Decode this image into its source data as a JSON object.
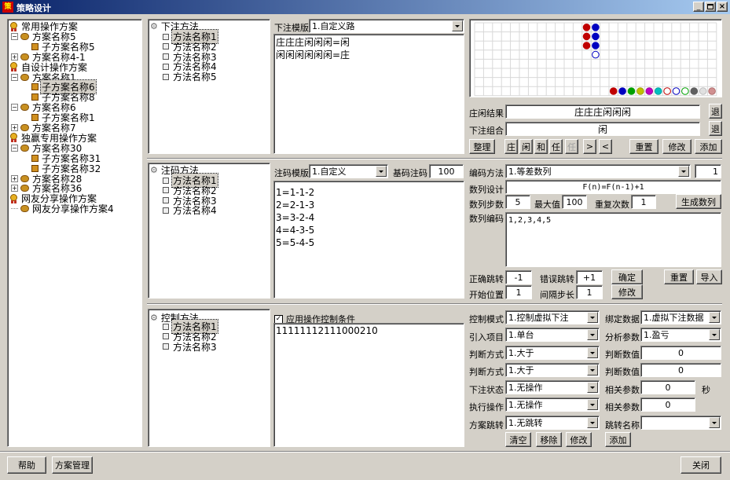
{
  "window": {
    "title": "策略设计"
  },
  "tree": {
    "items": [
      {
        "label": "常用操作方案",
        "level": 0,
        "icon": "award-icon"
      },
      {
        "label": "方案名称5",
        "level": 1,
        "icon": "plan-icon",
        "expand": "−"
      },
      {
        "label": "子方案名称5",
        "level": 2,
        "icon": "subplan-icon"
      },
      {
        "label": "方案名称4-1",
        "level": 1,
        "icon": "plan-icon",
        "expand": "+"
      },
      {
        "label": "自设计操作方案",
        "level": 0,
        "icon": "award-icon"
      },
      {
        "label": "方案名称1",
        "level": 1,
        "icon": "plan-icon",
        "expand": "−"
      },
      {
        "label": "子方案名称6",
        "level": 2,
        "icon": "subplan-icon",
        "selected": true
      },
      {
        "label": "子方案名称8",
        "level": 2,
        "icon": "subplan-icon"
      },
      {
        "label": "方案名称6",
        "level": 1,
        "icon": "plan-icon",
        "expand": "−"
      },
      {
        "label": "子方案名称1",
        "level": 2,
        "icon": "subplan-icon"
      },
      {
        "label": "方案名称7",
        "level": 1,
        "icon": "plan-icon",
        "expand": "+"
      },
      {
        "label": "独赢专用操作方案",
        "level": 0,
        "icon": "award-icon"
      },
      {
        "label": "方案名称30",
        "level": 1,
        "icon": "plan-icon",
        "expand": "−"
      },
      {
        "label": "子方案名称31",
        "level": 2,
        "icon": "subplan-icon"
      },
      {
        "label": "子方案名称32",
        "level": 2,
        "icon": "subplan-icon"
      },
      {
        "label": "方案名称28",
        "level": 1,
        "icon": "plan-icon",
        "expand": "+"
      },
      {
        "label": "方案名称36",
        "level": 1,
        "icon": "plan-icon",
        "expand": "+"
      },
      {
        "label": "网友分享操作方案",
        "level": 0,
        "icon": "award-icon"
      },
      {
        "label": "网友分享操作方案4",
        "level": 1,
        "icon": "plan-icon"
      }
    ]
  },
  "bet": {
    "root": "下注方法",
    "items": [
      "方法名称1",
      "方法名称2",
      "方法名称3",
      "方法名称4",
      "方法名称5"
    ],
    "template_label": "下注模版",
    "template_value": "1.自定义路",
    "lines": [
      "庄庄庄闲闲闲=闲",
      "闲闲闲闲闲闲=庄"
    ]
  },
  "bead": {
    "colors": [
      "#c00000",
      "#0000c0",
      "#00a000",
      "#c0c000",
      "#c000c0",
      "#00c0c0",
      "#ffffff",
      "#ffffff",
      "#ffffff",
      "#606060",
      "#e0e0e0",
      "#d09090"
    ]
  },
  "result": {
    "label": "庄闲结果",
    "value": "庄庄庄闲闲闲",
    "combo_label": "下注组合",
    "combo_value": "闲",
    "back1": "退",
    "back2": "退"
  },
  "toolbar": {
    "tidy": "整理",
    "zhuang": "庄",
    "xian": "闲",
    "he": "和",
    "ren": "任",
    "disabled": "任",
    "right": ">",
    "left": "<",
    "reset": "重置",
    "edit": "修改",
    "add": "添加"
  },
  "chip": {
    "root": "注码方法",
    "items": [
      "方法名称1",
      "方法名称2",
      "方法名称3",
      "方法名称4"
    ],
    "template_label": "注码模版",
    "template_value": "1.自定义",
    "base_label": "基码注码",
    "base_value": "100",
    "lines": [
      "1=1-1-2",
      "2=2-1-3",
      "3=3-2-4",
      "4=4-3-5",
      "5=5-4-5"
    ]
  },
  "seq": {
    "method_label": "编码方法",
    "method_value": "1.等差数列",
    "method_num": "1",
    "design_label": "数列设计",
    "design_value": "F(n)=F(n-1)+1",
    "step_label": "数列步数",
    "step_value": "5",
    "max_label": "最大值",
    "max_value": "100",
    "repeat_label": "重复次数",
    "repeat_value": "1",
    "gen_btn": "生成数列",
    "code_label": "数列编码",
    "code_value": "1,2,3,4,5",
    "ok_jump_label": "正确跳转",
    "ok_jump_value": "-1",
    "err_jump_label": "错误跳转",
    "err_jump_value": "+1",
    "confirm": "确定",
    "reset": "重置",
    "import": "导入",
    "start_label": "开始位置",
    "start_value": "1",
    "interval_label": "间隔步长",
    "interval_value": "1",
    "edit": "修改"
  },
  "control": {
    "root": "控制方法",
    "items": [
      "方法名称1",
      "方法名称2",
      "方法名称3"
    ],
    "apply_label": "应用操作控制条件",
    "apply_checked": "✓",
    "text": "11111112111000210",
    "mode_label": "控制模式",
    "mode_value": "1.控制虚拟下注",
    "bind_label": "绑定数据",
    "bind_value": "1.虚拟下注数据",
    "ref_label": "引入项目",
    "ref_value": "1.单台",
    "analysis_label": "分析参数",
    "analysis_value": "1.盈亏",
    "judge1_label": "判断方式",
    "judge1_value": "1.大于",
    "judgev1_label": "判断数值",
    "judgev1_value": "0",
    "judge2_label": "判断方式",
    "judge2_value": "1.大于",
    "judgev2_label": "判断数值",
    "judgev2_value": "0",
    "state_label": "下注状态",
    "state_value": "1.无操作",
    "param1_label": "相关参数",
    "param1_value": "0",
    "sec": "秒",
    "exec_label": "执行操作",
    "exec_value": "1.无操作",
    "param2_label": "相关参数",
    "param2_value": "0",
    "jump_label": "方案跳转",
    "jump_value": "1.无跳转",
    "jumpname_label": "跳转名称",
    "jumpname_value": "",
    "clear": "清空",
    "remove": "移除",
    "edit": "修改",
    "add": "添加"
  },
  "footer": {
    "help": "帮助",
    "manage": "方案管理",
    "close": "关闭"
  }
}
